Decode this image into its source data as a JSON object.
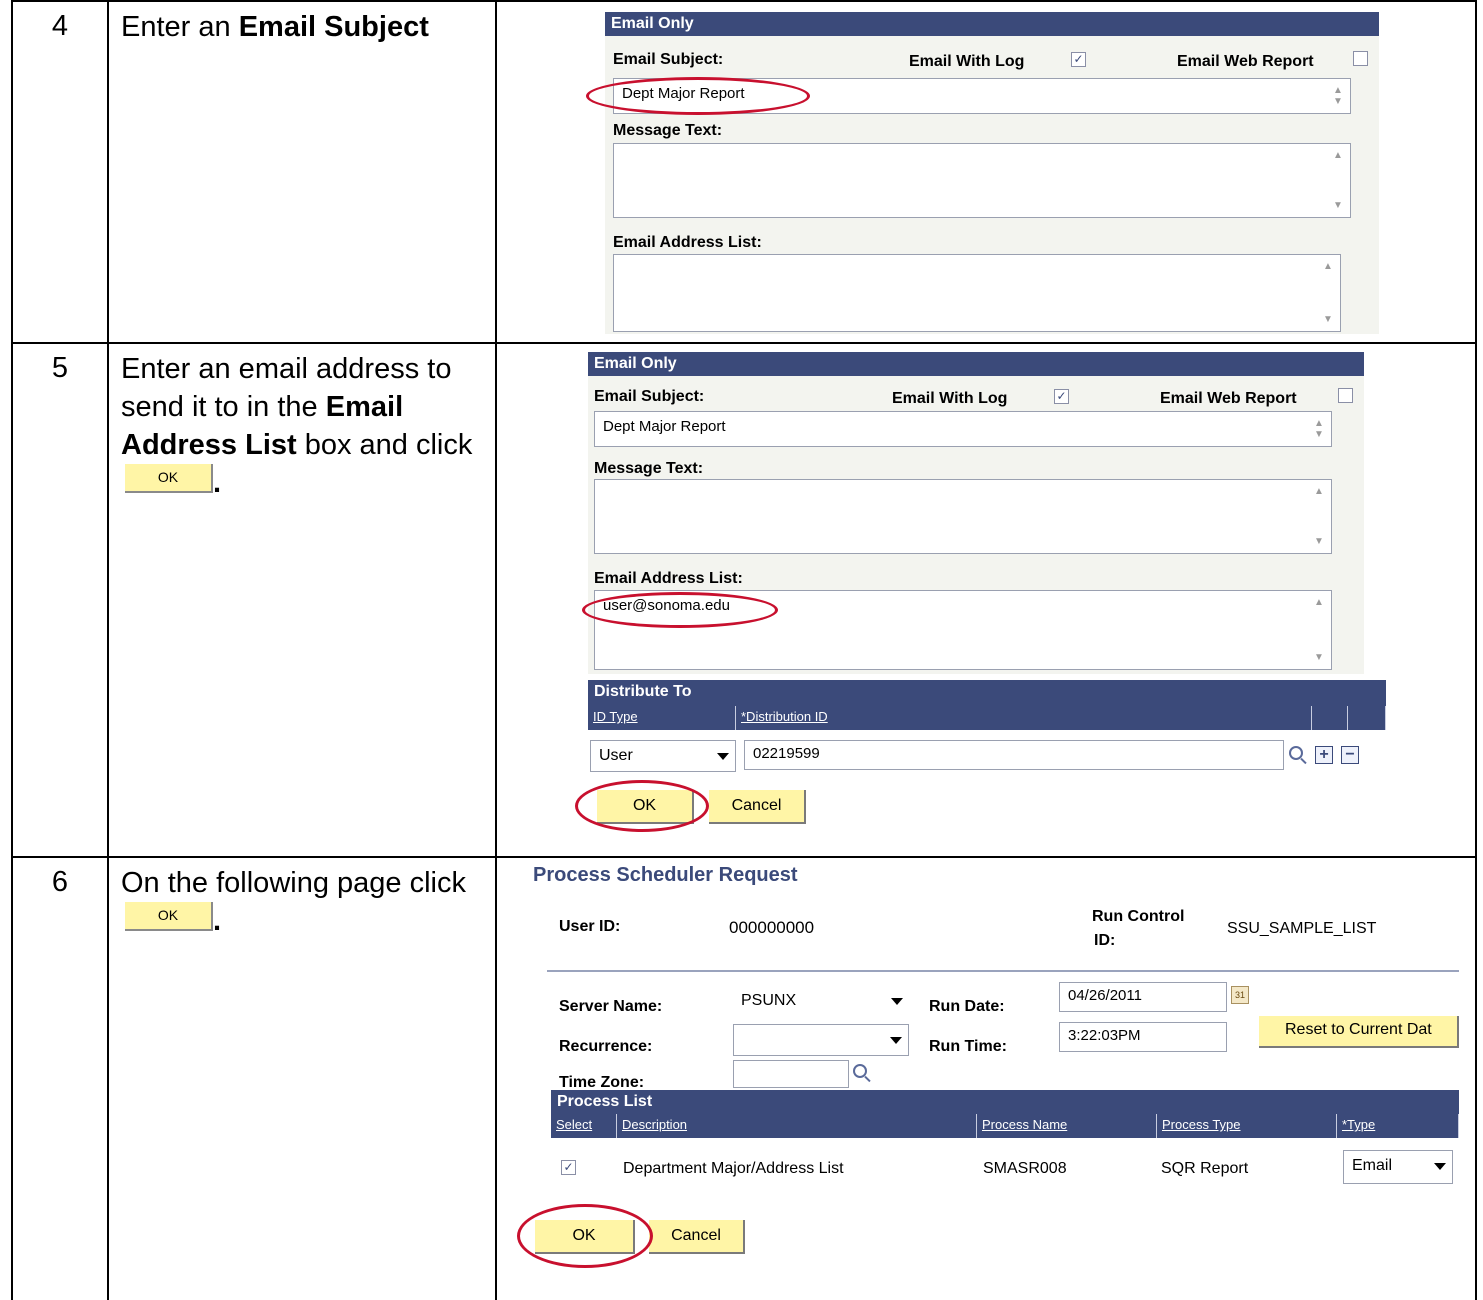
{
  "steps": [
    {
      "number": "4",
      "text_before": "Enter an ",
      "bold": "Email Subject"
    },
    {
      "number": "5",
      "text1": "Enter an email address to send it to in the ",
      "bold1": "Email Address List",
      "text2": " box and click ",
      "button": "OK",
      "period": "."
    },
    {
      "number": "6",
      "text1": "On the following page click ",
      "button": "OK",
      "period": "."
    }
  ],
  "email_panel": {
    "header": "Email Only",
    "subject_label": "Email Subject:",
    "email_with_log": "Email With Log",
    "email_web_report": "Email Web Report",
    "subject_value": "Dept Major Report",
    "message_label": "Message Text:",
    "address_label": "Email Address List:",
    "address_value": "user@sonoma.edu",
    "checkmark": "✓"
  },
  "distribute": {
    "header": "Distribute To",
    "col_id_type": "ID Type",
    "col_dist_id": "*Distribution ID",
    "id_type_value": "User",
    "dist_id_value": "02219599",
    "ok": "OK",
    "cancel": "Cancel"
  },
  "scheduler": {
    "title": "Process Scheduler Request",
    "user_id_label": "User ID:",
    "user_id_value": "000000000",
    "run_control_label_1": "Run Control",
    "run_control_label_2": "ID:",
    "run_control_value": "SSU_SAMPLE_LIST",
    "server_label": "Server Name:",
    "server_value": "PSUNX",
    "run_date_label": "Run Date:",
    "run_date_value": "04/26/2011",
    "recurrence_label": "Recurrence:",
    "run_time_label": "Run Time:",
    "run_time_value": "3:22:03PM",
    "reset_button": "Reset to Current Dat",
    "timezone_label": "Time Zone:",
    "calendar_glyph": "31",
    "process_list_header": "Process List",
    "columns": [
      "Select",
      "Description",
      "Process Name",
      "Process Type",
      "*Type"
    ],
    "row": {
      "description": "Department Major/Address List",
      "process_name": "SMASR008",
      "process_type": "SQR Report",
      "type": "Email"
    },
    "ok": "OK",
    "cancel": "Cancel"
  }
}
